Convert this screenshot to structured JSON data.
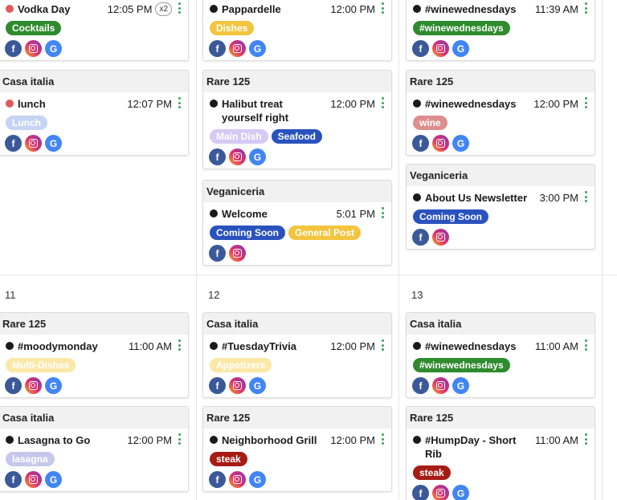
{
  "colors": {
    "tag_green": "#2e8b2e",
    "tag_yellow": "#f3c43d",
    "tag_lavender": "#c7c7ec",
    "tag_blue": "#2a52be",
    "tag_pink": "#dd8e8e",
    "tag_red": "#a61c14",
    "tag_pale_yellow": "#fbe8a6",
    "tag_pale_lavender": "#d5c9f5",
    "tag_light_blue": "#c5d3f5",
    "dot_black": "#1a1a1a",
    "dot_red": "#e05a5a"
  },
  "days": [
    {
      "number": "11"
    },
    {
      "number": "12"
    },
    {
      "number": "13"
    }
  ],
  "cards": [
    {
      "venue": "",
      "title": "Vodka Day",
      "time": "12:05 PM",
      "badge": "x2",
      "dot": "red",
      "tags": [
        {
          "label": "Cocktails",
          "color": "tag_green"
        }
      ],
      "socials": [
        "facebook-icon",
        "instagram-icon",
        "google-icon"
      ]
    },
    {
      "venue": "",
      "title": "Pappardelle",
      "time": "12:00 PM",
      "dot": "black",
      "tags": [
        {
          "label": "Dishes",
          "color": "tag_yellow"
        }
      ],
      "socials": [
        "facebook-icon",
        "instagram-icon",
        "google-icon"
      ]
    },
    {
      "venue": "",
      "title": "#winewednesdays",
      "time": "11:39 AM",
      "dot": "black",
      "tags": [
        {
          "label": "#winewednesdays",
          "color": "tag_green"
        }
      ],
      "socials": [
        "facebook-icon",
        "instagram-icon",
        "google-icon"
      ]
    },
    {
      "venue": "Casa italia",
      "title": "lunch",
      "time": "12:07 PM",
      "dot": "red",
      "tags": [
        {
          "label": "Lunch",
          "color": "tag_light_blue"
        }
      ],
      "socials": [
        "facebook-icon",
        "instagram-icon",
        "google-icon"
      ]
    },
    {
      "venue": "Rare 125",
      "title": "Halibut treat yourself right",
      "time": "12:00 PM",
      "dot": "black",
      "tags": [
        {
          "label": "Main Dish",
          "color": "tag_pale_lavender"
        },
        {
          "label": "Seafood",
          "color": "tag_blue"
        }
      ],
      "socials": [
        "facebook-icon",
        "instagram-icon",
        "google-icon"
      ]
    },
    {
      "venue": "Rare 125",
      "title": "#winewednesdays",
      "time": "12:00 PM",
      "dot": "black",
      "tags": [
        {
          "label": "wine",
          "color": "tag_pink"
        }
      ],
      "socials": [
        "facebook-icon",
        "instagram-icon",
        "google-icon"
      ]
    },
    {
      "venue": "Veganiceria",
      "title": "Welcome",
      "time": "5:01 PM",
      "dot": "black",
      "tags": [
        {
          "label": "Coming Soon",
          "color": "tag_blue"
        },
        {
          "label": "General Post",
          "color": "tag_yellow"
        }
      ],
      "socials": [
        "facebook-icon",
        "instagram-icon"
      ]
    },
    {
      "venue": "Veganiceria",
      "title": "About Us Newsletter",
      "time": "3:00 PM",
      "dot": "black",
      "tags": [
        {
          "label": "Coming Soon",
          "color": "tag_blue"
        }
      ],
      "socials": [
        "facebook-icon",
        "instagram-icon"
      ]
    },
    {
      "venue": "Rare 125",
      "title": "#moodymonday",
      "time": "11:00 AM",
      "dot": "black",
      "tags": [
        {
          "label": "Multi-Dishes",
          "color": "tag_pale_yellow"
        }
      ],
      "socials": [
        "facebook-icon",
        "instagram-icon",
        "google-icon"
      ]
    },
    {
      "venue": "Casa italia",
      "title": "#TuesdayTrivia",
      "time": "12:00 PM",
      "dot": "black",
      "tags": [
        {
          "label": "Appetizers",
          "color": "tag_pale_yellow"
        }
      ],
      "socials": [
        "facebook-icon",
        "instagram-icon",
        "google-icon"
      ]
    },
    {
      "venue": "Casa italia",
      "title": "#winewednesdays",
      "time": "11:00 AM",
      "dot": "black",
      "tags": [
        {
          "label": "#winewednesdays",
          "color": "tag_green"
        }
      ],
      "socials": [
        "facebook-icon",
        "instagram-icon",
        "google-icon"
      ]
    },
    {
      "venue": "Casa italia",
      "title": "Lasagna to Go",
      "time": "12:00 PM",
      "dot": "black",
      "tags": [
        {
          "label": "lasagna",
          "color": "tag_lavender"
        }
      ],
      "socials": [
        "facebook-icon",
        "instagram-icon",
        "google-icon"
      ]
    },
    {
      "venue": "Rare 125",
      "title": "Neighborhood Grill",
      "time": "12:00 PM",
      "dot": "black",
      "tags": [
        {
          "label": "steak",
          "color": "tag_red"
        }
      ],
      "socials": [
        "facebook-icon",
        "instagram-icon",
        "google-icon"
      ]
    },
    {
      "venue": "Rare 125",
      "title": "#HumpDay - Short Rib",
      "time": "11:00 AM",
      "dot": "black",
      "tags": [
        {
          "label": "steak",
          "color": "tag_red"
        }
      ],
      "socials": [
        "facebook-icon",
        "instagram-icon",
        "google-icon"
      ]
    }
  ]
}
